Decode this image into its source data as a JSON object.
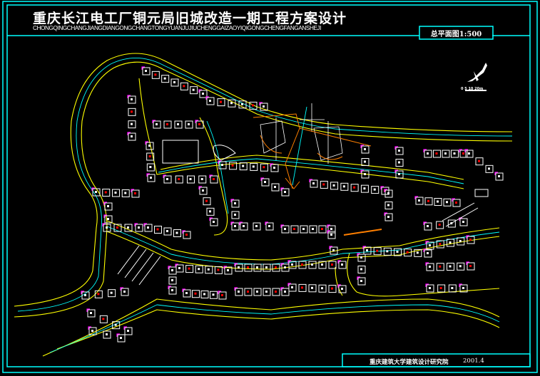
{
  "drawing": {
    "title": "重庆长江电工厂铜元局旧城改造一期工程方案设计",
    "subtitle": "CHONGQINGCHANGJIANGDIANGONGCHANGTONGYUANJUJIUCHENGGAIZAOYIQIGONGCHENGFANGANSHEJI",
    "sheet_label": "总平面图1:500",
    "scale_bar": "0 5 10 20m",
    "institute": "重庆建筑大学建筑设计研究院",
    "date": "2001.4"
  },
  "colors": {
    "frame": "#00ffff",
    "road_edge": "#ffff00",
    "road_center": "#00ffff",
    "building": "#ffffff",
    "building_corner": "#ff00ff",
    "path": "#ff7f00",
    "accent_red": "#ff0000"
  }
}
